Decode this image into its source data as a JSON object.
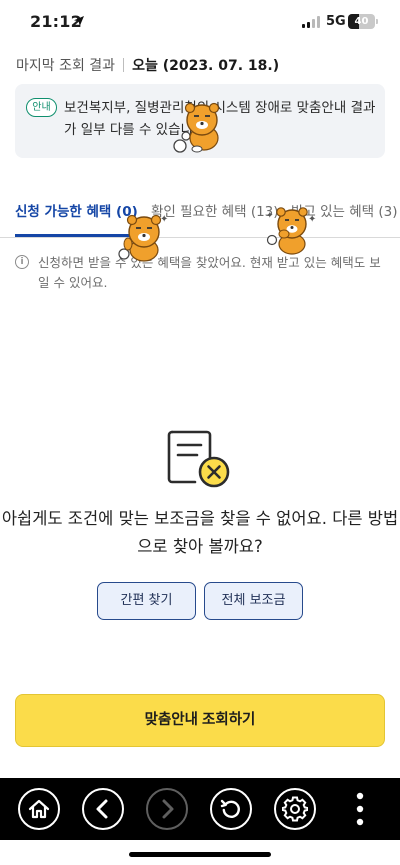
{
  "status_bar": {
    "time": "21:12",
    "network": "5G",
    "battery": "40",
    "battery_level": 0.4
  },
  "header": {
    "last_lookup_label": "마지막 조회 결과",
    "last_lookup_value": "오늘 (2023. 07. 18.)"
  },
  "notice": {
    "badge": "안내",
    "text": "보건복지부, 질병관리청의 시스템 장애로 맞춤안내 결과가 일부 다를 수 있습니다"
  },
  "tabs": [
    {
      "label": "신청 가능한 혜택 (0)",
      "active": true
    },
    {
      "label": "확인 필요한 혜택 (13)",
      "active": false
    },
    {
      "label": "받고 있는 혜택 (3)",
      "active": false
    }
  ],
  "info": {
    "icon": "info-icon",
    "text": "신청하면 받을 수 있는 혜택을 찾았어요. 현재 받고 있는 혜택도 보일 수 있어요."
  },
  "empty_state": {
    "icon": "document-x-icon",
    "message": "아쉽게도 조건에 맞는 보조금을 찾을 수 없어요. 다른 방법으로 찾아 볼까요?",
    "buttons": [
      "간편 찾기",
      "전체 보조금"
    ]
  },
  "cta": {
    "label": "맞춤안내 조회하기"
  },
  "toolbar": {
    "items": [
      "home-icon",
      "back-icon",
      "forward-icon",
      "refresh-icon",
      "settings-icon",
      "more-icon"
    ]
  },
  "colors": {
    "accent": "#1546a6",
    "cta": "#fbdc4a",
    "badge": "#0f8f6e",
    "notice_bg": "#f1f3f6"
  }
}
